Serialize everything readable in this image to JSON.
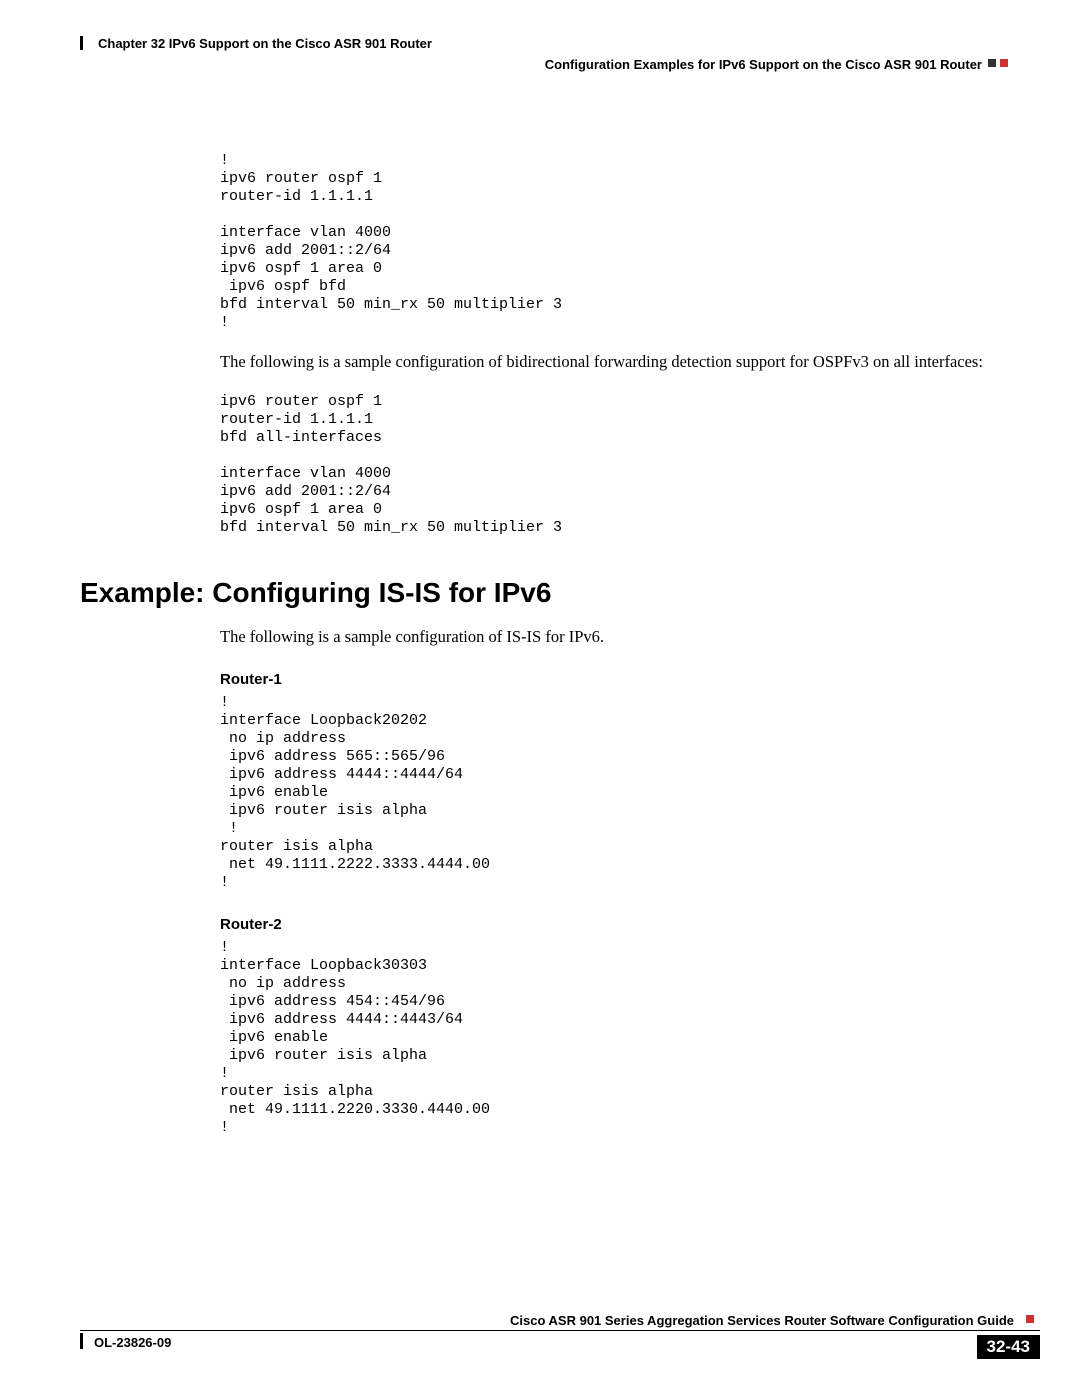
{
  "header": {
    "chapter": "Chapter 32      IPv6 Support on the Cisco ASR 901 Router",
    "section": "Configuration Examples for IPv6 Support on the Cisco ASR 901 Router"
  },
  "block1_code": "!\nipv6 router ospf 1\nrouter-id 1.1.1.1\n\ninterface vlan 4000\nipv6 add 2001::2/64\nipv6 ospf 1 area 0\n ipv6 ospf bfd\nbfd interval 50 min_rx 50 multiplier 3\n!",
  "para1": "The following is a sample configuration of bidirectional forwarding detection support for OSPFv3 on all interfaces:",
  "block2_code": "ipv6 router ospf 1\nrouter-id 1.1.1.1\nbfd all-interfaces\n\ninterface vlan 4000\nipv6 add 2001::2/64\nipv6 ospf 1 area 0\nbfd interval 50 min_rx 50 multiplier 3",
  "example_heading": "Example: Configuring IS-IS for IPv6",
  "para2": "The following is a sample configuration of IS-IS for IPv6.",
  "router1_heading": "Router-1",
  "router1_code": "!\ninterface Loopback20202\n no ip address\n ipv6 address 565::565/96\n ipv6 address 4444::4444/64\n ipv6 enable\n ipv6 router isis alpha\n !\nrouter isis alpha\n net 49.1111.2222.3333.4444.00\n!",
  "router2_heading": "Router-2",
  "router2_code": "!\ninterface Loopback30303\n no ip address\n ipv6 address 454::454/96\n ipv6 address 4444::4443/64\n ipv6 enable\n ipv6 router isis alpha\n!\nrouter isis alpha\n net 49.1111.2220.3330.4440.00\n!",
  "footer": {
    "guide": "Cisco ASR 901 Series Aggregation Services Router Software Configuration Guide",
    "doc_id": "OL-23826-09",
    "page": "32-43"
  }
}
